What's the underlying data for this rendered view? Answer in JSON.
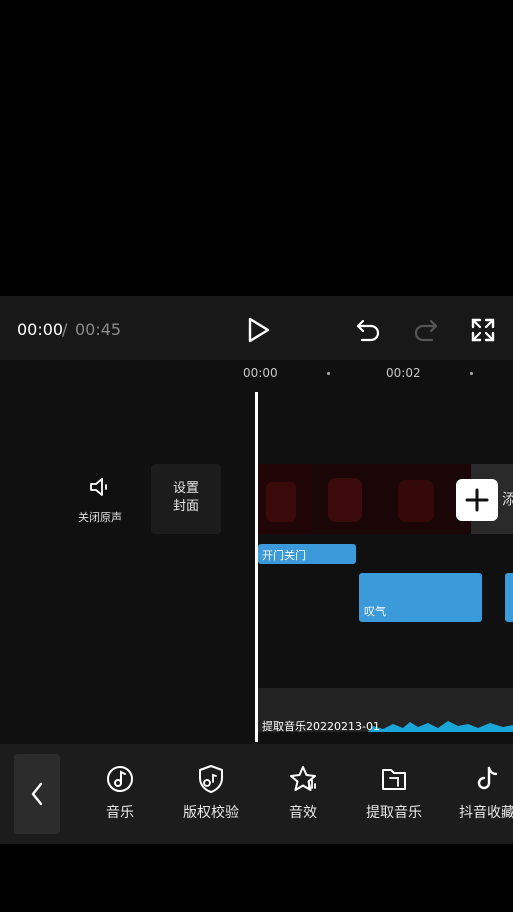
{
  "player": {
    "current_time": "00:00",
    "separator": "/",
    "total_time": "00:45"
  },
  "timeline": {
    "ticks": [
      "00:00",
      "00:02"
    ],
    "mute_label": "关闭原声",
    "cover_label_line1": "设置",
    "cover_label_line2": "封面",
    "add_label": "添",
    "sfx_clips": [
      "开门关门",
      "叹气"
    ],
    "music_clip": "提取音乐20220213-01"
  },
  "toolbar": {
    "items": [
      {
        "label": "音乐",
        "icon": "music-note-icon"
      },
      {
        "label": "版权校验",
        "icon": "copyright-shield-icon"
      },
      {
        "label": "音效",
        "icon": "sound-effect-star-icon"
      },
      {
        "label": "提取音乐",
        "icon": "folder-icon"
      },
      {
        "label": "抖音收藏",
        "icon": "tiktok-icon"
      }
    ]
  },
  "colors": {
    "clip_blue": "#3b9ad9",
    "audio_wave": "#1aa7d8",
    "background": "#000000"
  }
}
